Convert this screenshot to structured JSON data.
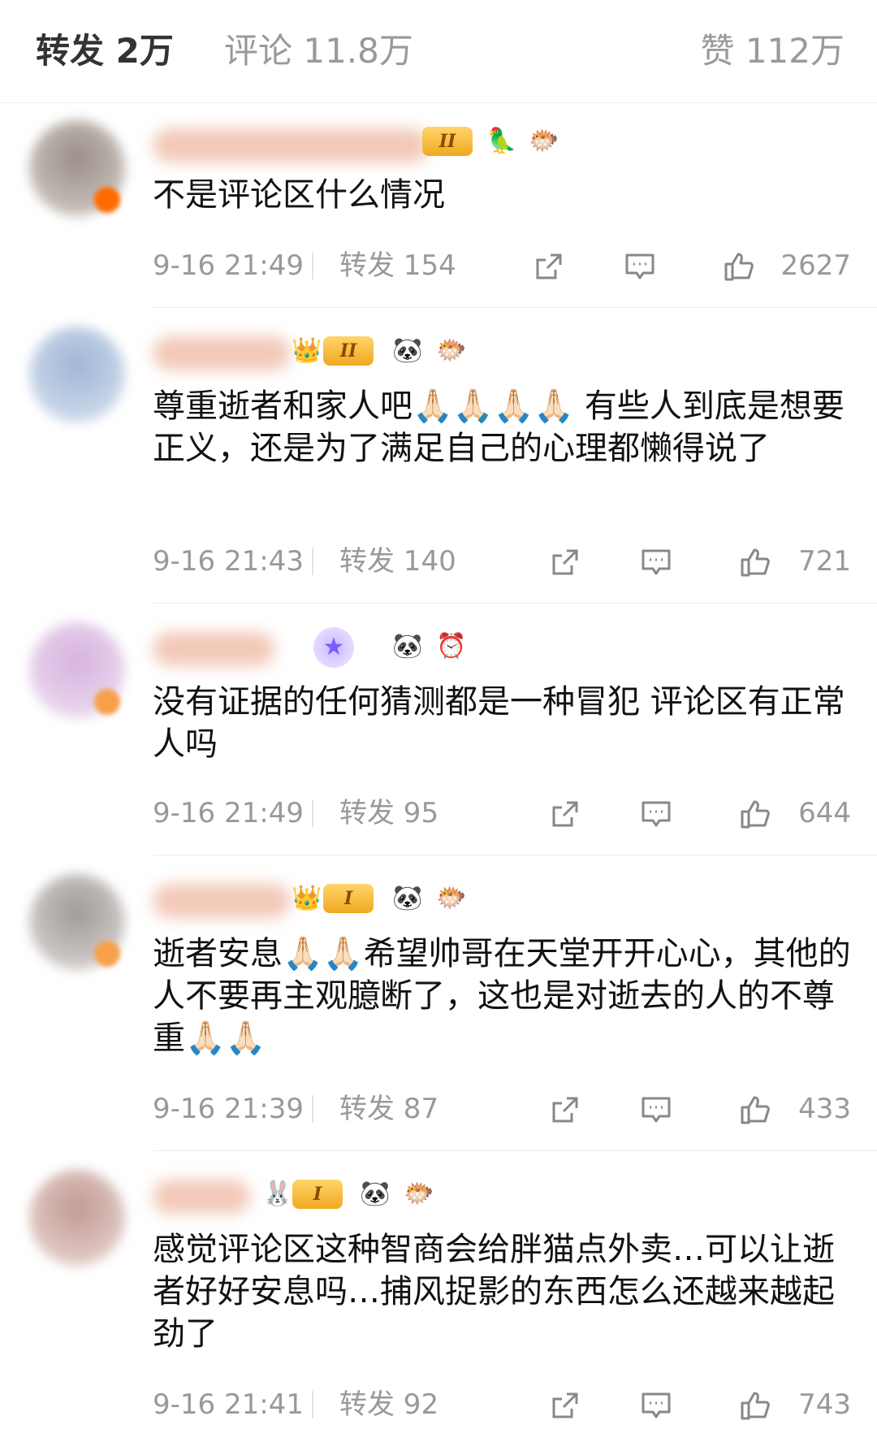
{
  "tabs": {
    "repost": "转发 2万",
    "comments": "评论 11.8万",
    "likes": "赞 112万"
  },
  "comments": [
    {
      "text": "不是评论区什么情况",
      "time": "9-16 21:49",
      "repost": "转发 154",
      "likes": "2627",
      "level": "II"
    },
    {
      "text": "尊重逝者和家人吧🙏🏻🙏🏻🙏🏻🙏🏻 有些人到底是想要正义，还是为了满足自己的心理都懒得说了",
      "time": "9-16 21:43",
      "repost": "转发 140",
      "likes": "721",
      "level": "II"
    },
    {
      "text": "没有证据的任何猜测都是一种冒犯 评论区有正常人吗",
      "time": "9-16 21:49",
      "repost": "转发 95",
      "likes": "644"
    },
    {
      "text": "逝者安息🙏🏻🙏🏻希望帅哥在天堂开开心心，其他的人不要再主观臆断了，这也是对逝去的人的不尊重🙏🏻🙏🏻",
      "time": "9-16 21:39",
      "repost": "转发 87",
      "likes": "433",
      "level": "I"
    },
    {
      "text": "感觉评论区这种智商会给胖猫点外卖…可以让逝者好好安息吗…捕风捉影的东西怎么还越来越起劲了",
      "time": "9-16 21:41",
      "repost": "转发 92",
      "likes": "743",
      "level": "I"
    }
  ],
  "icons": {
    "repost": "share-icon",
    "comment": "comment-icon",
    "like": "thumbs-up-icon",
    "panda": "🐼",
    "pufferfish": "🐡",
    "parrot": "🦜",
    "clock": "⏰",
    "crown": "👑"
  },
  "colors": {
    "accent": "#f4a03a",
    "meta_gray": "#999999",
    "text": "#111111"
  }
}
